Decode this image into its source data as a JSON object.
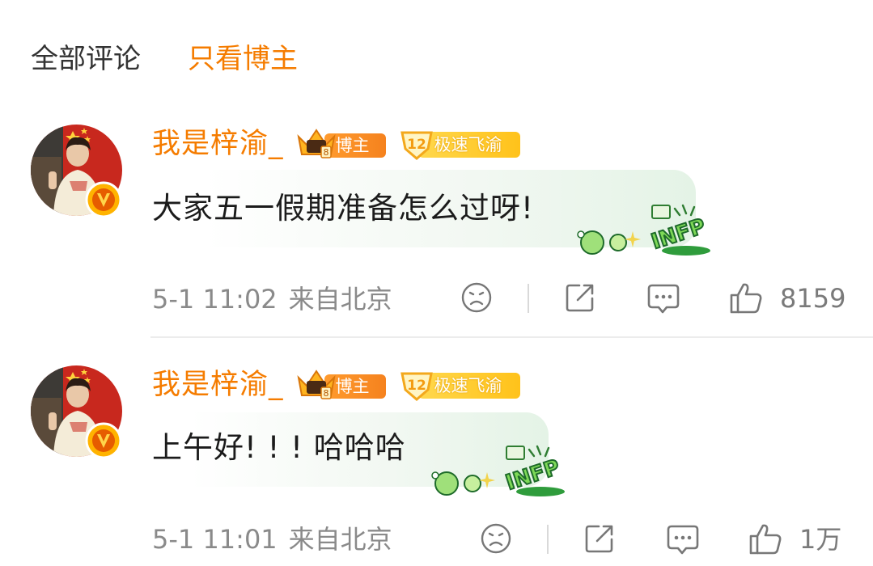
{
  "tabs": {
    "all": "全部评论",
    "blogger_only": "只看博主"
  },
  "colors": {
    "accent": "#f57c00",
    "meta_gray": "#8a8a8a",
    "bubble_green": "#e4f3e6"
  },
  "comments": [
    {
      "username": "我是梓渝_",
      "badge_blogger": "博主",
      "badge_level_num": "12",
      "badge_level_label": "极速飞渝",
      "text": "大家五一假期准备怎么过呀!",
      "decoration": "INFP",
      "time": "5-1 11:02",
      "location": "来自北京",
      "likes": "8159",
      "icons": [
        "sad-face-icon",
        "share-icon",
        "comment-icon",
        "like-icon"
      ]
    },
    {
      "username": "我是梓渝_",
      "badge_blogger": "博主",
      "badge_level_num": "12",
      "badge_level_label": "极速飞渝",
      "text": "上午好! ! ! 哈哈哈",
      "decoration": "INFP",
      "time": "5-1 11:01",
      "location": "来自北京",
      "likes": "1万",
      "icons": [
        "sad-face-icon",
        "share-icon",
        "comment-icon",
        "like-icon"
      ]
    }
  ]
}
